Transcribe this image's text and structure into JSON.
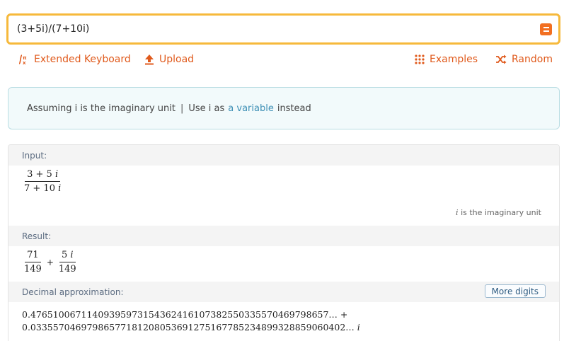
{
  "search": {
    "query": "(3+5i)/(7+10i)"
  },
  "toolbar": {
    "keyboard_label": "Extended Keyboard",
    "upload_label": "Upload",
    "examples_label": "Examples",
    "random_label": "Random"
  },
  "assumption": {
    "text": "Assuming i is the imaginary unit",
    "separator": "|",
    "use_text": "Use i as",
    "link_text": "a variable",
    "suffix": "instead"
  },
  "pods": {
    "input": {
      "title": "Input:",
      "numerator": "3 + 5 ",
      "denominator": "7 + 10 ",
      "imag_symbol": "i",
      "note_symbol": "i",
      "note": "is the imaginary unit"
    },
    "result": {
      "title": "Result:",
      "term1_num": "71",
      "term1_den": "149",
      "plus": "+",
      "term2_num": "5 ",
      "term2_den": "149",
      "imag_symbol": "i"
    },
    "decimal": {
      "title": "Decimal approximation:",
      "more_digits_label": "More digits",
      "line1": "0.47651006711409395973154362416107382550335570469798657… +",
      "line2": "0.03355704697986577181208053691275167785234899328859060402… ",
      "imag_symbol": "i"
    }
  },
  "colors": {
    "accent_orange": "#e05a1c",
    "search_border": "#f6b93b",
    "link_blue": "#3d8fb5"
  }
}
